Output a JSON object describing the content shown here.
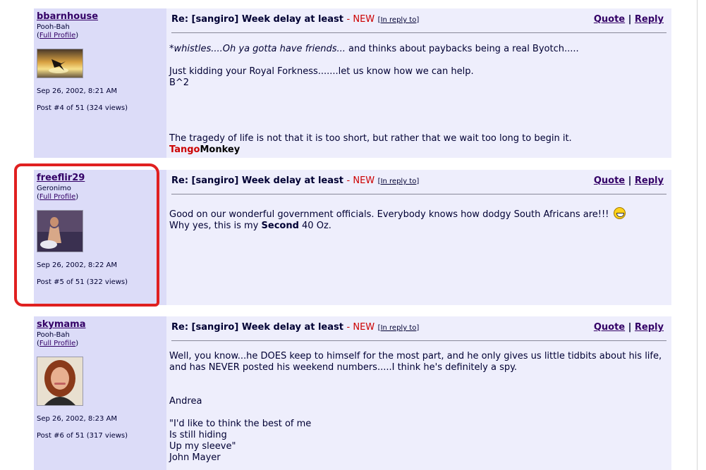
{
  "posts": [
    {
      "username": "bbarnhouse",
      "rank": "Pooh-Bah",
      "profile_link": "Full Profile",
      "avatar_icon": "skydiver-sunset-avatar",
      "date": "Sep 26, 2002, 8:21 AM",
      "post_info": "Post #4 of 51 (324 views)",
      "subject": "Re: [sangiro] Week delay at least",
      "new_label": "- NEW",
      "in_reply_to": "In reply to",
      "quote": "Quote",
      "reply": "Reply",
      "body_lines": [
        {
          "italic": "*whistles....Oh ya gotta have friends...",
          "rest": " and thinks about paybacks being a real Byotch....."
        },
        "",
        "Just kidding your Royal Forkness.......let us know how we can help.",
        "B^2"
      ],
      "signature": "The tragedy of life is not that it is too short, but rather that we wait too long to begin it.",
      "sig_name_red": "Tango",
      "sig_name_black": "Monkey"
    },
    {
      "username": "freeflir29",
      "rank": "Geronimo",
      "profile_link": "Full Profile",
      "avatar_icon": "person-photo-avatar",
      "date": "Sep 26, 2002, 8:22 AM",
      "post_info": "Post #5 of 51 (322 views)",
      "subject": "Re: [sangiro] Week delay at least",
      "new_label": "- NEW",
      "in_reply_to": "In reply to",
      "quote": "Quote",
      "reply": "Reply",
      "body_line1": "Good on our wonderful government officials. Everybody knows how dodgy South Africans are!!!",
      "body_line2_pre": "Why yes, this is my ",
      "body_line2_bold": "Second",
      "body_line2_post": " 40 Oz."
    },
    {
      "username": "skymama",
      "rank": "Pooh-Bah",
      "profile_link": "Full Profile",
      "avatar_icon": "woman-portrait-avatar",
      "date": "Sep 26, 2002, 8:23 AM",
      "post_info": "Post #6 of 51 (317 views)",
      "subject": "Re: [sangiro] Week delay at least",
      "new_label": "- NEW",
      "in_reply_to": "In reply to",
      "quote": "Quote",
      "reply": "Reply",
      "body_text": "Well, you know...he DOES keep to himself for the most part, and he only gives us little tidbits about his life, and has NEVER posted his weekend numbers.....I think he's definitely a spy.\n\n\nAndrea\n\n\"I'd like to think the best of me\nIs still hiding\nUp my sleeve\"\nJohn Mayer"
    }
  ],
  "colors": {
    "left_panel": "#dcdcf8",
    "right_panel": "#eeeefc",
    "new_red": "#cc0000",
    "highlight_red": "#e02020"
  }
}
